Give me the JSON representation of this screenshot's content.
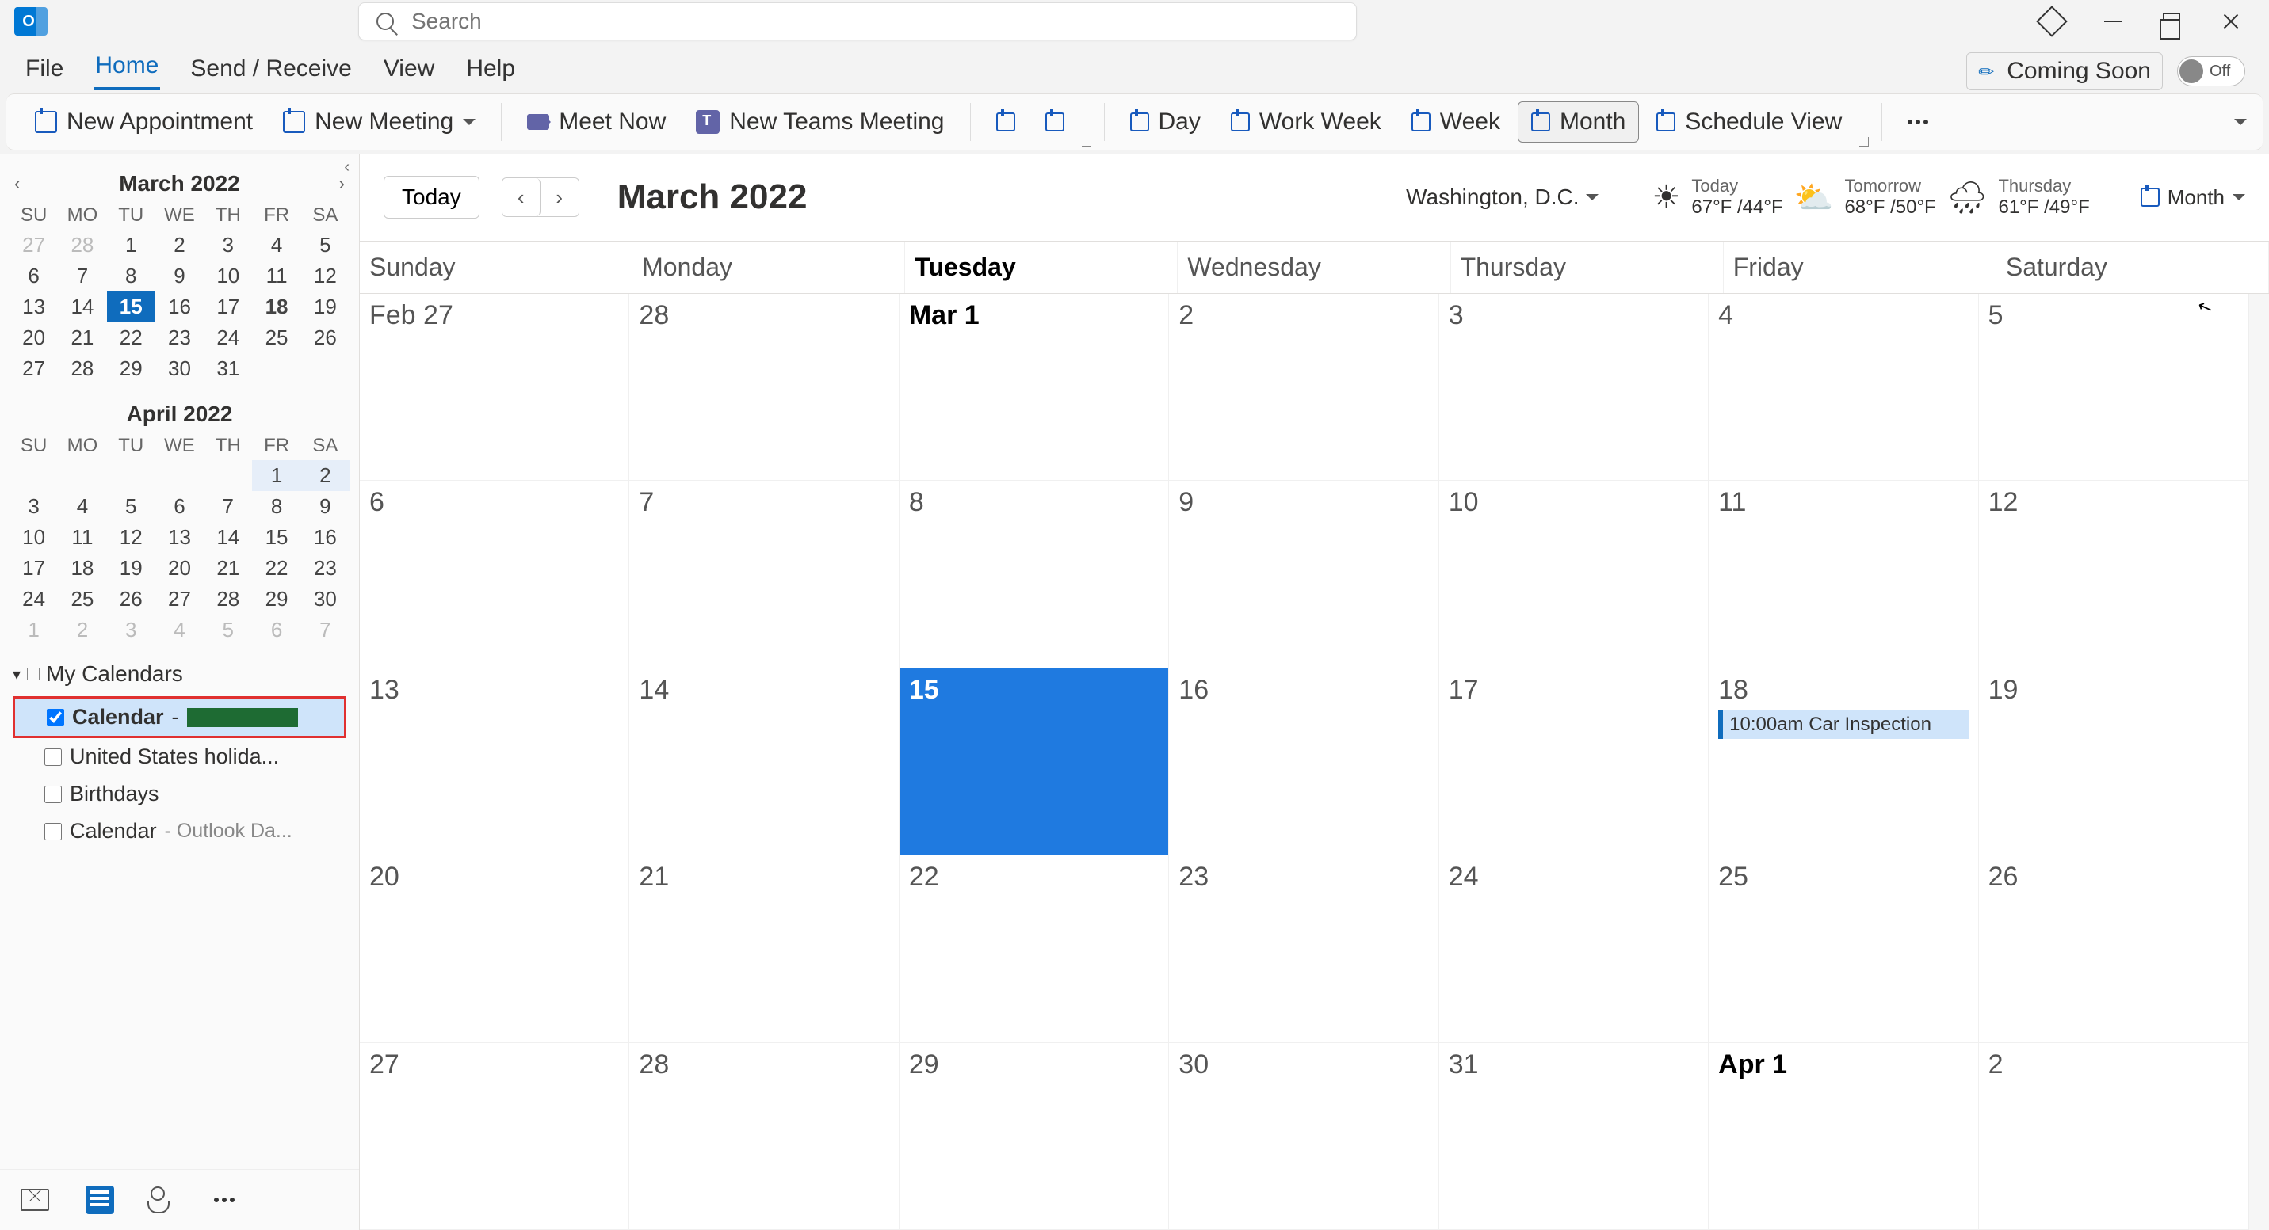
{
  "titlebar": {
    "search_placeholder": "Search"
  },
  "menubar": {
    "items": [
      "File",
      "Home",
      "Send / Receive",
      "View",
      "Help"
    ],
    "active": 1,
    "coming_soon": "Coming Soon",
    "toggle_label": "Off"
  },
  "ribbon": {
    "new_appointment": "New Appointment",
    "new_meeting": "New Meeting",
    "meet_now": "Meet Now",
    "new_teams_meeting": "New Teams Meeting",
    "day": "Day",
    "work_week": "Work Week",
    "week": "Week",
    "month": "Month",
    "schedule_view": "Schedule View"
  },
  "sidebar": {
    "mini1": {
      "label": "March 2022",
      "dow": [
        "SU",
        "MO",
        "TU",
        "WE",
        "TH",
        "FR",
        "SA"
      ],
      "rows": [
        [
          {
            "d": "27",
            "o": true
          },
          {
            "d": "28",
            "o": true
          },
          {
            "d": "1"
          },
          {
            "d": "2"
          },
          {
            "d": "3"
          },
          {
            "d": "4"
          },
          {
            "d": "5"
          }
        ],
        [
          {
            "d": "6"
          },
          {
            "d": "7"
          },
          {
            "d": "8"
          },
          {
            "d": "9"
          },
          {
            "d": "10"
          },
          {
            "d": "11"
          },
          {
            "d": "12"
          }
        ],
        [
          {
            "d": "13"
          },
          {
            "d": "14"
          },
          {
            "d": "15",
            "today": true
          },
          {
            "d": "16"
          },
          {
            "d": "17"
          },
          {
            "d": "18",
            "bold": true
          },
          {
            "d": "19"
          }
        ],
        [
          {
            "d": "20"
          },
          {
            "d": "21"
          },
          {
            "d": "22"
          },
          {
            "d": "23"
          },
          {
            "d": "24"
          },
          {
            "d": "25"
          },
          {
            "d": "26"
          }
        ],
        [
          {
            "d": "27"
          },
          {
            "d": "28"
          },
          {
            "d": "29"
          },
          {
            "d": "30"
          },
          {
            "d": "31"
          },
          {
            "d": "",
            "o": true
          },
          {
            "d": "",
            "o": true
          }
        ]
      ]
    },
    "mini2": {
      "label": "April 2022",
      "dow": [
        "SU",
        "MO",
        "TU",
        "WE",
        "TH",
        "FR",
        "SA"
      ],
      "rows": [
        [
          {
            "d": ""
          },
          {
            "d": ""
          },
          {
            "d": ""
          },
          {
            "d": ""
          },
          {
            "d": ""
          },
          {
            "d": "1",
            "hl": true
          },
          {
            "d": "2",
            "hl": true
          }
        ],
        [
          {
            "d": "3"
          },
          {
            "d": "4"
          },
          {
            "d": "5"
          },
          {
            "d": "6"
          },
          {
            "d": "7"
          },
          {
            "d": "8"
          },
          {
            "d": "9"
          }
        ],
        [
          {
            "d": "10"
          },
          {
            "d": "11"
          },
          {
            "d": "12"
          },
          {
            "d": "13"
          },
          {
            "d": "14"
          },
          {
            "d": "15"
          },
          {
            "d": "16"
          }
        ],
        [
          {
            "d": "17"
          },
          {
            "d": "18"
          },
          {
            "d": "19"
          },
          {
            "d": "20"
          },
          {
            "d": "21"
          },
          {
            "d": "22"
          },
          {
            "d": "23"
          }
        ],
        [
          {
            "d": "24"
          },
          {
            "d": "25"
          },
          {
            "d": "26"
          },
          {
            "d": "27"
          },
          {
            "d": "28"
          },
          {
            "d": "29"
          },
          {
            "d": "30"
          }
        ],
        [
          {
            "d": "1",
            "o": true
          },
          {
            "d": "2",
            "o": true
          },
          {
            "d": "3",
            "o": true
          },
          {
            "d": "4",
            "o": true
          },
          {
            "d": "5",
            "o": true
          },
          {
            "d": "6",
            "o": true
          },
          {
            "d": "7",
            "o": true
          }
        ]
      ]
    },
    "group_label": "My Calendars",
    "cal_items": [
      {
        "label": "Calendar",
        "checked": true,
        "selected": true,
        "suffix": "-",
        "redacted": true
      },
      {
        "label": "United States holida...",
        "checked": false
      },
      {
        "label": "Birthdays",
        "checked": false
      },
      {
        "label": "Calendar",
        "checked": false,
        "dim": "- Outlook Da..."
      }
    ]
  },
  "calendar": {
    "today_btn": "Today",
    "title": "March 2022",
    "location": "Washington,  D.C.",
    "weather": [
      {
        "icon": "☀",
        "l1": "Today",
        "l2": "67°F /44°F"
      },
      {
        "icon": "⛅",
        "l1": "Tomorrow",
        "l2": "68°F /50°F"
      },
      {
        "icon": "🌧",
        "l1": "Thursday",
        "l2": "61°F /49°F"
      }
    ],
    "view_label": "Month",
    "dow": [
      "Sunday",
      "Monday",
      "Tuesday",
      "Wednesday",
      "Thursday",
      "Friday",
      "Saturday"
    ],
    "today_dow_index": 2,
    "weeks": [
      [
        {
          "n": "Feb 27"
        },
        {
          "n": "28"
        },
        {
          "n": "Mar 1",
          "bold": true
        },
        {
          "n": "2"
        },
        {
          "n": "3"
        },
        {
          "n": "4"
        },
        {
          "n": "5"
        }
      ],
      [
        {
          "n": "6"
        },
        {
          "n": "7"
        },
        {
          "n": "8"
        },
        {
          "n": "9"
        },
        {
          "n": "10"
        },
        {
          "n": "11"
        },
        {
          "n": "12"
        }
      ],
      [
        {
          "n": "13"
        },
        {
          "n": "14"
        },
        {
          "n": "15",
          "selected": true
        },
        {
          "n": "16"
        },
        {
          "n": "17"
        },
        {
          "n": "18",
          "event": "10:00am Car Inspection"
        },
        {
          "n": "19"
        }
      ],
      [
        {
          "n": "20"
        },
        {
          "n": "21"
        },
        {
          "n": "22"
        },
        {
          "n": "23"
        },
        {
          "n": "24"
        },
        {
          "n": "25"
        },
        {
          "n": "26"
        }
      ],
      [
        {
          "n": "27"
        },
        {
          "n": "28"
        },
        {
          "n": "29"
        },
        {
          "n": "30"
        },
        {
          "n": "31"
        },
        {
          "n": "Apr 1",
          "bold": true
        },
        {
          "n": "2"
        }
      ]
    ]
  }
}
